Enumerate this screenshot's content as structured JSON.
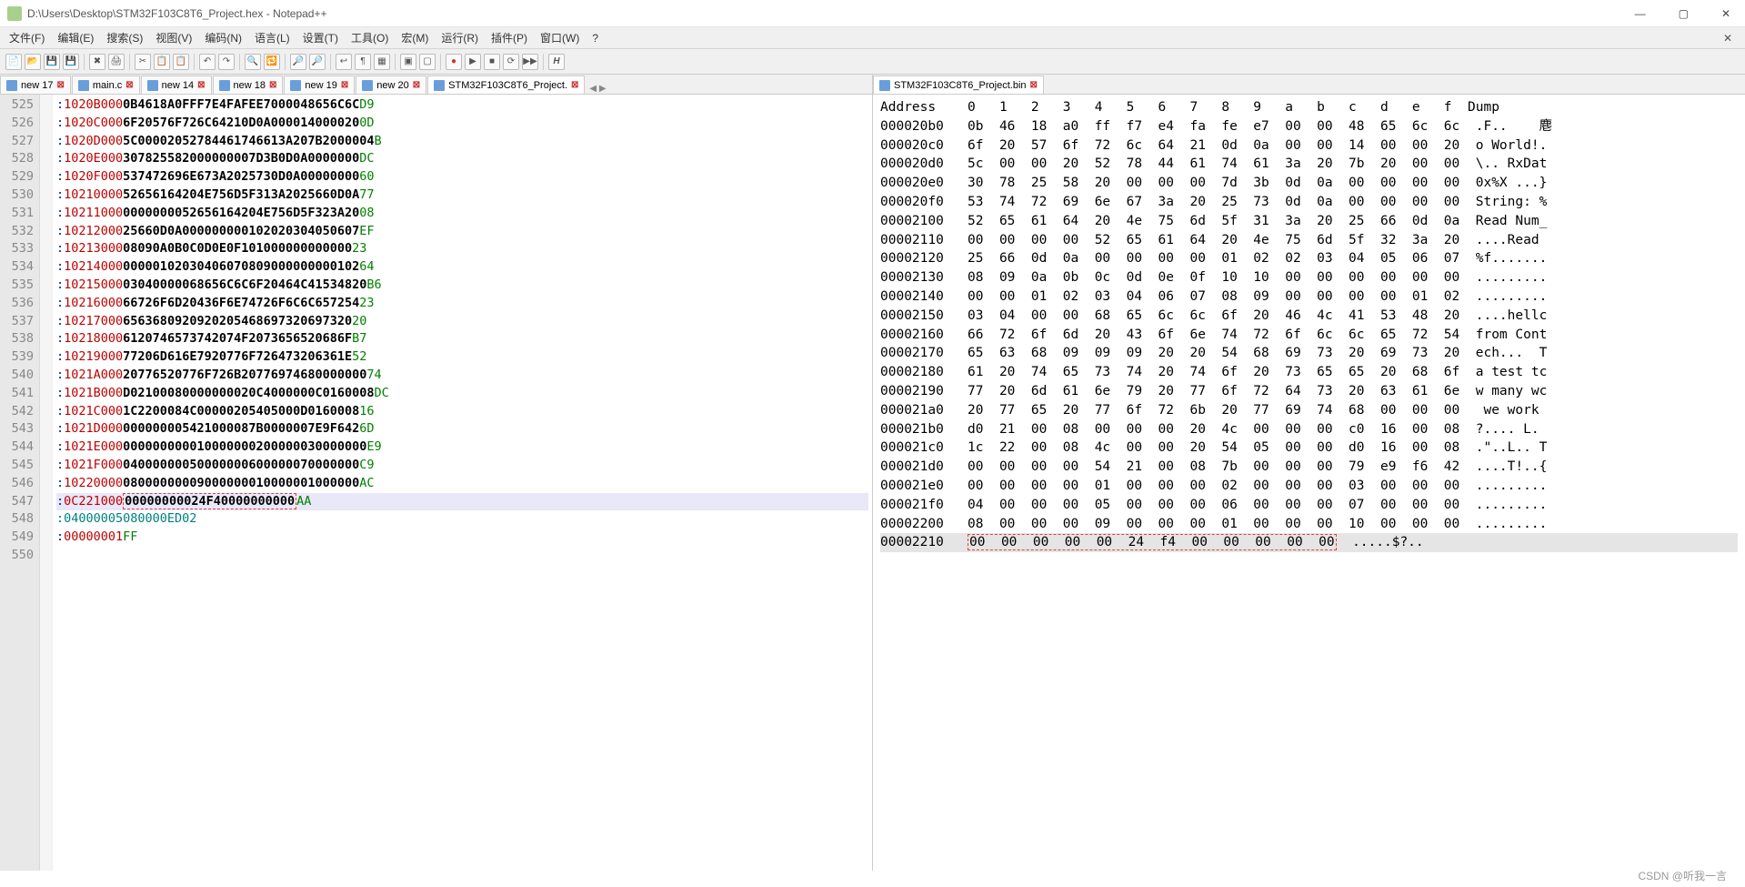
{
  "title": "D:\\Users\\Desktop\\STM32F103C8T6_Project.hex - Notepad++",
  "menus": [
    "文件(F)",
    "编辑(E)",
    "搜索(S)",
    "视图(V)",
    "编码(N)",
    "语言(L)",
    "设置(T)",
    "工具(O)",
    "宏(M)",
    "运行(R)",
    "插件(P)",
    "窗口(W)",
    "?"
  ],
  "left_tabs": [
    {
      "label": "new 17",
      "active": false
    },
    {
      "label": "main.c",
      "active": false
    },
    {
      "label": "new 14",
      "active": false
    },
    {
      "label": "new 18",
      "active": false
    },
    {
      "label": "new 19",
      "active": false
    },
    {
      "label": "new 20",
      "active": false
    },
    {
      "label": "STM32F103C8T6_Project.",
      "active": true
    }
  ],
  "right_tabs": [
    {
      "label": "STM32F103C8T6_Project.bin",
      "active": true
    }
  ],
  "hex_lines": [
    {
      "n": 525,
      "pre": ":",
      "addr": "1020B000",
      "data": "0B4618A0FFF7E4FAFEE7000048656C6C",
      "chk": "D9"
    },
    {
      "n": 526,
      "pre": ":",
      "addr": "1020C000",
      "data": "6F20576F726C64210D0A000014000020",
      "chk": "0D"
    },
    {
      "n": 527,
      "pre": ":",
      "addr": "1020D000",
      "data": "5C00002052784461746613A207B2000004",
      "chk": "B"
    },
    {
      "n": 528,
      "pre": ":",
      "addr": "1020E000",
      "data": "307825582000000007D3B0D0A0000000",
      "chk": "DC"
    },
    {
      "n": 529,
      "pre": ":",
      "addr": "1020F000",
      "data": "537472696E673A2025730D0A00000000",
      "chk": "60"
    },
    {
      "n": 530,
      "pre": ":",
      "addr": "10210000",
      "data": "52656164204E756D5F313A2025660D0A",
      "chk": "77"
    },
    {
      "n": 531,
      "pre": ":",
      "addr": "10211000",
      "data": "0000000052656164204E756D5F323A20",
      "chk": "08"
    },
    {
      "n": 532,
      "pre": ":",
      "addr": "10212000",
      "data": "25660D0A000000000102020304050607",
      "chk": "EF"
    },
    {
      "n": 533,
      "pre": ":",
      "addr": "10213000",
      "data": "08090A0B0C0D0E0F101000000000000",
      "chk": "23"
    },
    {
      "n": 534,
      "pre": ":",
      "addr": "10214000",
      "data": "00000102030406070809000000000102",
      "chk": "64"
    },
    {
      "n": 535,
      "pre": ":",
      "addr": "10215000",
      "data": "03040000068656C6C6F20464C41534820",
      "chk": "B6"
    },
    {
      "n": 536,
      "pre": ":",
      "addr": "10216000",
      "data": "66726F6D20436F6E74726F6C6C657254",
      "chk": "23"
    },
    {
      "n": 537,
      "pre": ":",
      "addr": "10217000",
      "data": "6563680920920205468697320697320",
      "chk": "20"
    },
    {
      "n": 538,
      "pre": ":",
      "addr": "10218000",
      "data": "6120746573742074F2073656520686F",
      "chk": "B7"
    },
    {
      "n": 539,
      "pre": ":",
      "addr": "10219000",
      "data": "77206D616E7920776F726473206361E",
      "chk": "52"
    },
    {
      "n": 540,
      "pre": ":",
      "addr": "1021A000",
      "data": "20776520776F726B20776974680000000",
      "chk": "74"
    },
    {
      "n": 541,
      "pre": ":",
      "addr": "1021B000",
      "data": "D02100080000000020C4000000C0160008",
      "chk": "DC"
    },
    {
      "n": 542,
      "pre": ":",
      "addr": "1021C000",
      "data": "1C2200084C00000205405000D0160008",
      "chk": "16"
    },
    {
      "n": 543,
      "pre": ":",
      "addr": "1021D000",
      "data": "000000005421000087B0000007E9F642",
      "chk": "6D"
    },
    {
      "n": 544,
      "pre": ":",
      "addr": "1021E000",
      "data": "000000000010000000200000030000000",
      "chk": "E9"
    },
    {
      "n": 545,
      "pre": ":",
      "addr": "1021F000",
      "data": "04000000050000000600000070000000",
      "chk": "C9"
    },
    {
      "n": 546,
      "pre": ":",
      "addr": "10220000",
      "data": "08000000009000000010000001000000",
      "chk": "AC"
    },
    {
      "n": 547,
      "pre": ":",
      "addr": "0C221000",
      "data_boxed": "00000000024F40000000000",
      "chk": "AA",
      "hl": true
    },
    {
      "n": 548,
      "pre": ":",
      "addr": "04000005",
      "data": "080000ED",
      "chk": "02",
      "teal": true
    },
    {
      "n": 549,
      "pre": ":",
      "addr": "00000001",
      "data": "",
      "chk": "FF"
    },
    {
      "n": 550,
      "pre": "",
      "addr": "",
      "data": "",
      "chk": ""
    }
  ],
  "bin_header": "Address    0   1   2   3   4   5   6   7   8   9   a   b   c   d   e   f  Dump",
  "bin_lines": [
    {
      "addr": "000020b0",
      "hex": "0b 46 18 a0 ff f7 e4 fa fe e7 00 00 48 65 6c 6c",
      "dump": ".F..    麀"
    },
    {
      "addr": "000020c0",
      "hex": "6f 20 57 6f 72 6c 64 21 0d 0a 00 00 14 00 00 20",
      "dump": "o World!."
    },
    {
      "addr": "000020d0",
      "hex": "5c 00 00 20 52 78 44 61 74 61 3a 20 7b 20 00 00",
      "dump": "\\.. RxDat"
    },
    {
      "addr": "000020e0",
      "hex": "30 78 25 58 20 00 00 00 7d 3b 0d 0a 00 00 00 00",
      "dump": "0x%X ...}"
    },
    {
      "addr": "000020f0",
      "hex": "53 74 72 69 6e 67 3a 20 25 73 0d 0a 00 00 00 00",
      "dump": "String: %"
    },
    {
      "addr": "00002100",
      "hex": "52 65 61 64 20 4e 75 6d 5f 31 3a 20 25 66 0d 0a",
      "dump": "Read Num_"
    },
    {
      "addr": "00002110",
      "hex": "00 00 00 00 52 65 61 64 20 4e 75 6d 5f 32 3a 20",
      "dump": "....Read "
    },
    {
      "addr": "00002120",
      "hex": "25 66 0d 0a 00 00 00 00 01 02 02 03 04 05 06 07",
      "dump": "%f......."
    },
    {
      "addr": "00002130",
      "hex": "08 09 0a 0b 0c 0d 0e 0f 10 10 00 00 00 00 00 00",
      "dump": "........."
    },
    {
      "addr": "00002140",
      "hex": "00 00 01 02 03 04 06 07 08 09 00 00 00 00 01 02",
      "dump": "........."
    },
    {
      "addr": "00002150",
      "hex": "03 04 00 00 68 65 6c 6c 6f 20 46 4c 41 53 48 20",
      "dump": "....hellc"
    },
    {
      "addr": "00002160",
      "hex": "66 72 6f 6d 20 43 6f 6e 74 72 6f 6c 6c 65 72 54",
      "dump": "from Cont"
    },
    {
      "addr": "00002170",
      "hex": "65 63 68 09 09 09 20 20 54 68 69 73 20 69 73 20",
      "dump": "ech...  T"
    },
    {
      "addr": "00002180",
      "hex": "61 20 74 65 73 74 20 74 6f 20 73 65 65 20 68 6f",
      "dump": "a test tc"
    },
    {
      "addr": "00002190",
      "hex": "77 20 6d 61 6e 79 20 77 6f 72 64 73 20 63 61 6e",
      "dump": "w many wc"
    },
    {
      "addr": "000021a0",
      "hex": "20 77 65 20 77 6f 72 6b 20 77 69 74 68 00 00 00",
      "dump": " we work "
    },
    {
      "addr": "000021b0",
      "hex": "d0 21 00 08 00 00 00 20 4c 00 00 00 c0 16 00 08",
      "dump": "?.... L."
    },
    {
      "addr": "000021c0",
      "hex": "1c 22 00 08 4c 00 00 20 54 05 00 00 d0 16 00 08",
      "dump": ".\"..L.. T"
    },
    {
      "addr": "000021d0",
      "hex": "00 00 00 00 54 21 00 08 7b 00 00 00 79 e9 f6 42",
      "dump": "....T!..{"
    },
    {
      "addr": "000021e0",
      "hex": "00 00 00 00 01 00 00 00 02 00 00 00 03 00 00 00",
      "dump": "........."
    },
    {
      "addr": "000021f0",
      "hex": "04 00 00 00 05 00 00 00 06 00 00 00 07 00 00 00",
      "dump": "........."
    },
    {
      "addr": "00002200",
      "hex": "08 00 00 00 09 00 00 00 01 00 00 00 10 00 00 00",
      "dump": "........."
    },
    {
      "addr": "00002210",
      "hex": "00 00 00 00 00 24 f4 00 00 00 00 00",
      "dump": ".....$?..",
      "last": true,
      "boxed": true
    }
  ],
  "footer": "CSDN @听我一言"
}
